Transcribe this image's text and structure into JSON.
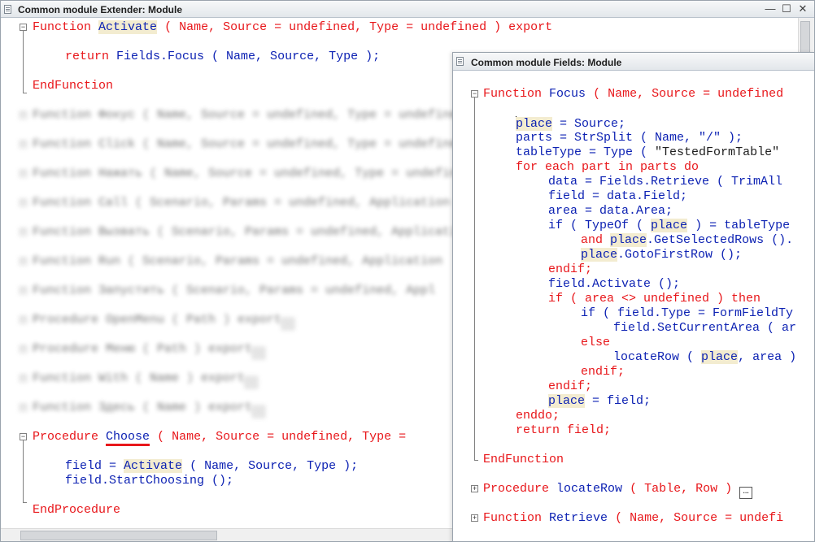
{
  "window1": {
    "title": "Common module Extender: Module",
    "controls": {
      "minimize": "—",
      "maximize": "☐",
      "close": "✕"
    }
  },
  "window2": {
    "title": "Common module Fields: Module"
  },
  "code1": {
    "fn_activate": {
      "kw": "Function",
      "name": "Activate",
      "args": "( Name, Source = undefined, Type = undefined ) export"
    },
    "return_line": {
      "kw": "return",
      "rest": "Fields.Focus ( Name, Source, Type );"
    },
    "endfunction": "EndFunction",
    "blurred": [
      "Function Фокус ( Name, Source = undefined, Type = undefined",
      "Function Click ( Name, Source = undefined, Type = undefined",
      "Function Нажать ( Name, Source = undefined, Type = undefined",
      "Function Call ( Scenario, Params = undefined, Application",
      "Function Вызвать ( Scenario, Params = undefined, Application",
      "Function Run ( Scenario, Params = undefined, Application",
      "Function Запустить ( Scenario, Params = undefined, Appl",
      "Procedure OpenMenu ( Path ) export",
      "Procedure Меню ( Path ) export",
      "Function With ( Name ) export",
      "Function Здесь ( Name ) export"
    ],
    "proc_choose": {
      "kw": "Procedure",
      "name": "Choose",
      "args": "( Name, Source = undefined, Type ="
    },
    "field_line": {
      "a": "field =",
      "b": "Activate",
      "c": "( Name, Source, Type );"
    },
    "start_line": "field.StartChoosing ();",
    "endprocedure": "EndProcedure"
  },
  "code2": {
    "fn_focus": {
      "kw": "Function",
      "name": "Focus",
      "args": "( Name, Source = undefined"
    },
    "l1": {
      "a": "place",
      "b": " = Source;"
    },
    "l2": "parts = StrSplit ( Name, \"/\" );",
    "l3": {
      "a": "tableType = Type (",
      "b": "\"TestedFormTable\""
    },
    "l4": "for each part in parts do",
    "l5": "data = Fields.Retrieve ( TrimAll",
    "l6": "field = data.Field;",
    "l7": "area = data.Area;",
    "l8": {
      "a": "if ( TypeOf (",
      "b": "place",
      "c": ") = tableType"
    },
    "l9": {
      "a": "and",
      "b": "place",
      "c": ".GetSelectedRows ()."
    },
    "l10": {
      "a": "place",
      "b": ".GotoFirstRow ();"
    },
    "l11": "endif;",
    "l12": "field.Activate ();",
    "l13": "if ( area <> undefined ) then",
    "l14": "if ( field.Type = FormFieldTy",
    "l15": "field.SetCurrentArea ( ar",
    "l16": "else",
    "l17": {
      "a": "locateRow (",
      "b": "place",
      "c": ", area )"
    },
    "l18": "endif;",
    "l19": "endif;",
    "l20": {
      "a": "place",
      "b": " = field;"
    },
    "l21": "enddo;",
    "l22": "return field;",
    "endfunction": "EndFunction",
    "proc_locate": {
      "kw": "Procedure",
      "name": "locateRow",
      "args": "( Table, Row )"
    },
    "fn_retrieve": {
      "kw": "Function",
      "name": "Retrieve",
      "args": "( Name, Source = undefi"
    }
  },
  "colors": {
    "keyword": "#e8171b",
    "identifier": "#0d22b3",
    "highlight": "#f3ecd0"
  }
}
